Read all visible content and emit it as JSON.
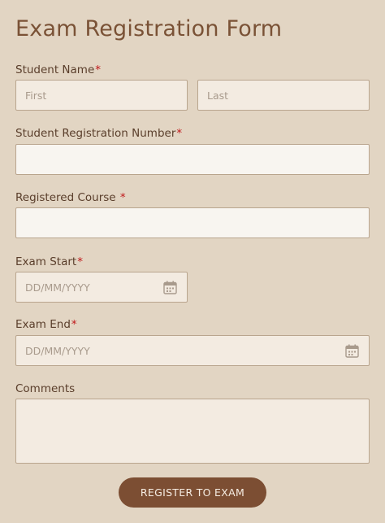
{
  "form": {
    "title": "Exam Registration Form",
    "required_marker": "*",
    "student_name": {
      "label": "Student Name",
      "first_placeholder": "First",
      "last_placeholder": "Last"
    },
    "registration_number": {
      "label": "Student Registration Number",
      "value": ""
    },
    "registered_course": {
      "label": "Registered Course ",
      "value": ""
    },
    "exam_start": {
      "label": "Exam Start",
      "placeholder": "DD/MM/YYYY",
      "icon": "calendar-icon"
    },
    "exam_end": {
      "label": "Exam End",
      "placeholder": "DD/MM/YYYY",
      "icon": "calendar-icon"
    },
    "comments": {
      "label": "Comments",
      "value": ""
    },
    "submit_label": "REGISTER TO EXAM"
  },
  "colors": {
    "background": "#e2d5c3",
    "title": "#7a5236",
    "required": "#c0181a",
    "button": "#7c4e33"
  }
}
